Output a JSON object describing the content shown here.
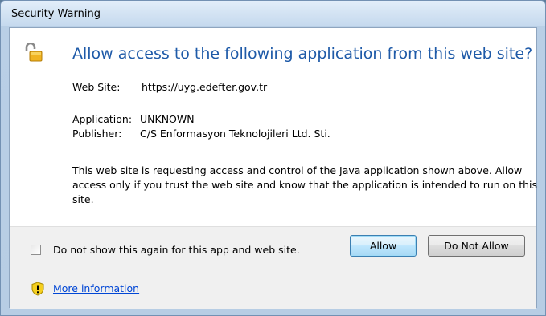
{
  "window": {
    "title": "Security Warning"
  },
  "dialog": {
    "heading": "Allow access to the following application from this web site?",
    "website_label": "Web Site:",
    "website_value": "https://uyg.edefter.gov.tr",
    "application_label": "Application:",
    "application_value": "UNKNOWN",
    "publisher_label": "Publisher:",
    "publisher_value": "C/S Enformasyon Teknolojileri Ltd. Sti.",
    "description": "This web site is requesting access and control of the Java application shown above. Allow access only if you trust the web site and know that the application is intended to run on this site."
  },
  "footer": {
    "checkbox_label": "Do not show this again for this app and web site.",
    "checkbox_checked": false,
    "allow_label": "Allow",
    "do_not_allow_label": "Do Not Allow",
    "more_info_label": "More information"
  },
  "icons": {
    "lock": "unlocked-padlock-icon",
    "shield": "warning-shield-icon"
  },
  "colors": {
    "heading": "#1e5aa8",
    "link": "#0046d5",
    "default_button": "#3c7fb1"
  }
}
